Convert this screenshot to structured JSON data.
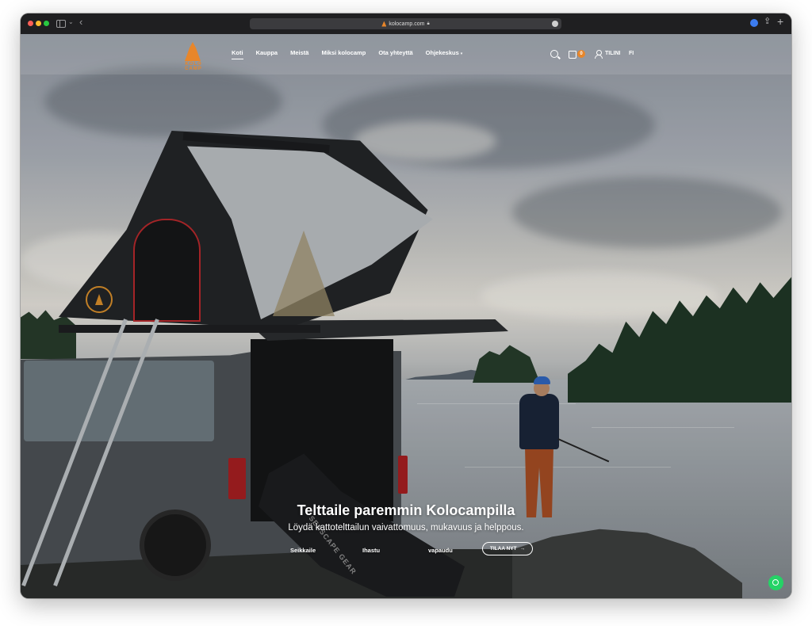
{
  "browser": {
    "url": "kolocamp.com"
  },
  "site": {
    "brand_text": "KOLO CAMP",
    "nav": [
      {
        "label": "Koti",
        "active": true
      },
      {
        "label": "Kauppa",
        "active": false
      },
      {
        "label": "Meistä",
        "active": false
      },
      {
        "label": "Miksi kolocamp",
        "active": false
      },
      {
        "label": "Ota yhteyttä",
        "active": false
      },
      {
        "label": "Ohjekeskus",
        "active": false
      }
    ],
    "cart_count": "0",
    "account_label": "TILINI",
    "language": "FI"
  },
  "hero": {
    "title": "Telttaile paremmin Kolocampilla",
    "subtitle": "Löydä kattotelttailun vaivattomuus, mukavuus ja helppous.",
    "links": [
      "Seikkaile",
      "Ihastu",
      "vapaudu"
    ],
    "cta_label": "TILAA NYT",
    "cta_arrow": "→",
    "kayak_text": "SEASCAPE GEAR"
  },
  "colors": {
    "accent": "#e8862a",
    "whatsapp": "#25d366"
  },
  "icons": [
    "search-icon",
    "cart-icon",
    "user-icon",
    "whatsapp-icon",
    "sidebar-toggle-icon",
    "back-icon",
    "share-icon",
    "new-tab-icon",
    "lock-icon",
    "reload-icon"
  ]
}
